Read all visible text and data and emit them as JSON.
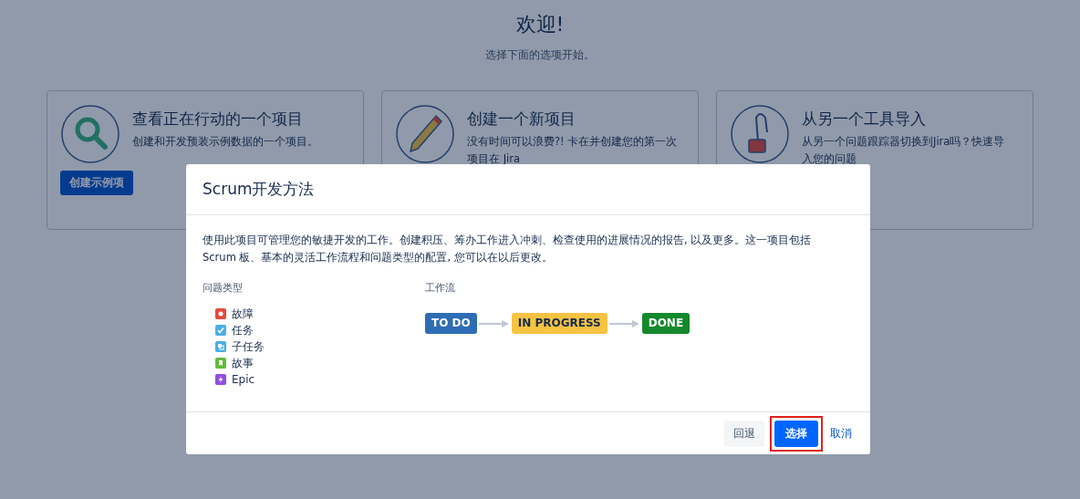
{
  "header": {
    "title": "欢迎!",
    "subtitle": "选择下面的选项开始。"
  },
  "cards": [
    {
      "kind": "search",
      "title": "查看正在行动的一个项目",
      "lines": [
        "创建和开发预装示例数据的一个项目。"
      ],
      "button": "创建示例项"
    },
    {
      "kind": "pencil",
      "title": "创建一个新项目",
      "lines": [
        "没有时间可以浪费?! 卡在并创建您的第一次",
        "项目在 Jira"
      ]
    },
    {
      "kind": "import",
      "title": "从另一个工具导入",
      "lines": [
        "从另一个问题跟踪器切换到Jira吗？快速导",
        "入您的问题"
      ]
    }
  ],
  "dialog": {
    "title": "Scrum开发方法",
    "description": "使用此项目可管理您的敏捷开发的工作。创建积压、筹办工作进入冲刺、检查使用的进展情况的报告, 以及更多。这一项目包括 Scrum 板、基本的灵活工作流程和问题类型的配置, 您可以在以后更改。",
    "issue_types_label": "问题类型",
    "issue_types": [
      {
        "kind": "bug",
        "label": "故障",
        "color": "#e5493a"
      },
      {
        "kind": "task",
        "label": "任务",
        "color": "#4bade8"
      },
      {
        "kind": "subtask",
        "label": "子任务",
        "color": "#4bade8"
      },
      {
        "kind": "story",
        "label": "故事",
        "color": "#63ba3c"
      },
      {
        "kind": "epic",
        "label": "Epic",
        "color": "#904ee2"
      }
    ],
    "workflow_label": "工作流",
    "workflow": [
      {
        "label": "TO DO",
        "color": "#2e6db4"
      },
      {
        "label": "IN PROGRESS",
        "color": "#f6c342"
      },
      {
        "label": "DONE",
        "color": "#14892c"
      }
    ],
    "buttons": [
      {
        "label": "回退",
        "kind": "default",
        "highlighted": false
      },
      {
        "label": "选择",
        "kind": "primary",
        "highlighted": true
      },
      {
        "label": "取消",
        "kind": "link",
        "highlighted": false
      }
    ]
  }
}
